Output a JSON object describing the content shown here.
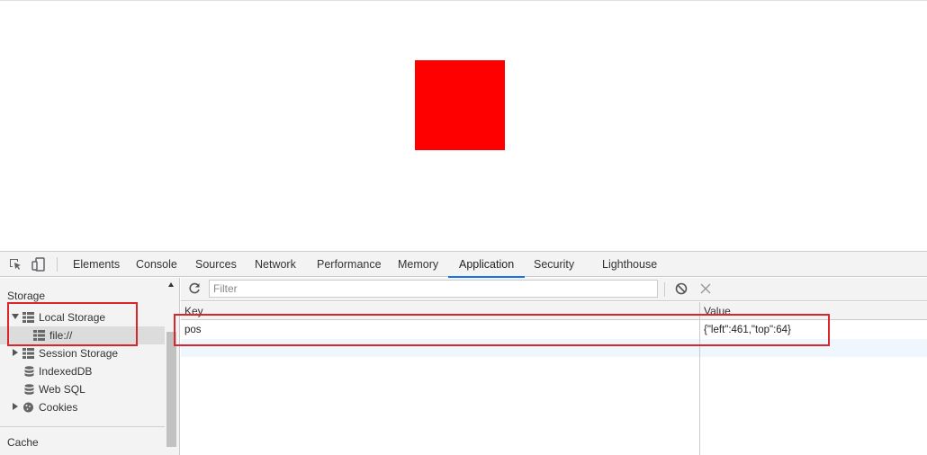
{
  "devtools": {
    "tabs": [
      "Elements",
      "Console",
      "Sources",
      "Network",
      "Performance",
      "Memory",
      "Application",
      "Security",
      "Lighthouse"
    ],
    "active_tab": "Application"
  },
  "sidebar": {
    "storage_heading": "Storage",
    "items": [
      {
        "label": "Local Storage",
        "expanded": true,
        "icon": "grid-icon"
      },
      {
        "label": "file://",
        "selected": true,
        "icon": "grid-icon"
      },
      {
        "label": "Session Storage",
        "expanded": false,
        "icon": "grid-icon"
      },
      {
        "label": "IndexedDB",
        "icon": "database-icon"
      },
      {
        "label": "Web SQL",
        "icon": "database-icon"
      },
      {
        "label": "Cookies",
        "expanded": false,
        "icon": "cookie-icon"
      }
    ],
    "cache_heading": "Cache"
  },
  "filter": {
    "placeholder": "Filter"
  },
  "table": {
    "headers": {
      "key": "Key",
      "value": "Value"
    },
    "rows": [
      {
        "key": "pos",
        "value": "{\"left\":461,\"top\":64}"
      }
    ]
  },
  "colors": {
    "accent": "#1a73e8",
    "highlight": "#d9262c",
    "box": "#ff0000"
  }
}
